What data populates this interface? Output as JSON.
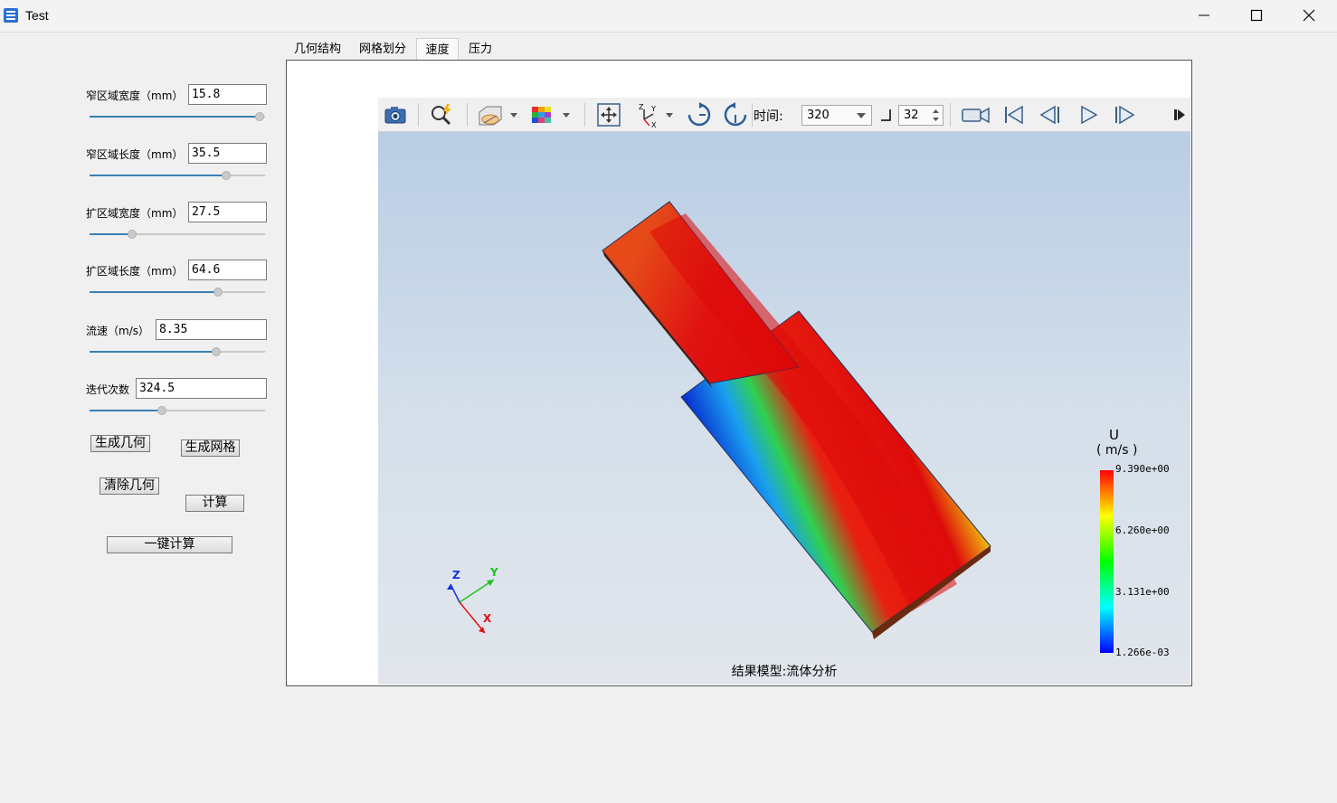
{
  "window": {
    "title": "Test"
  },
  "params": [
    {
      "label": "窄区域宽度（mm）",
      "value": "15.8",
      "level": 0.97
    },
    {
      "label": "窄区域长度（mm）",
      "value": "35.5",
      "level": 0.78
    },
    {
      "label": "扩区域宽度（mm）",
      "value": "27.5",
      "level": 0.24
    },
    {
      "label": "扩区域长度（mm）",
      "value": "64.6",
      "level": 0.73
    },
    {
      "label": "流速（m/s）",
      "value": "8.35",
      "level": 0.72
    },
    {
      "label": "迭代次数",
      "value": "324.5",
      "level": 0.41
    }
  ],
  "buttons": {
    "gen_geometry": "生成几何",
    "gen_mesh": "生成网格",
    "clear_geometry": "清除几何",
    "compute": "计算",
    "one_click": "一键计算"
  },
  "tabs": [
    {
      "label": "几何结构",
      "active": false
    },
    {
      "label": "网格划分",
      "active": false
    },
    {
      "label": "速度",
      "active": true
    },
    {
      "label": "压力",
      "active": false
    }
  ],
  "toolbar": {
    "time_label": "时间:",
    "time_value": "320",
    "step_value": "32",
    "icons": [
      "camera-icon",
      "zoom-icon",
      "display-mode-icon",
      "color-cube-icon",
      "fit-view-icon",
      "axes-icon",
      "rotate-cw-icon",
      "rotate-ccw-icon",
      "record-icon",
      "first-frame-icon",
      "prev-frame-icon",
      "play-icon",
      "next-frame-icon",
      "expand-icon"
    ]
  },
  "viewer": {
    "caption": "结果模型:流体分析",
    "legend": {
      "title": "U",
      "unit": "( m/s )",
      "ticks": [
        "9.390e+00",
        "6.260e+00",
        "3.131e+00",
        "1.266e-03"
      ]
    },
    "axes": {
      "x": "X",
      "y": "Y",
      "z": "Z"
    }
  },
  "colors": {
    "slider_fill": "#3c7fb1",
    "bg_top": "#b9cde4",
    "bg_bottom": "#e2e6ec",
    "axis_x": "#e01010",
    "axis_y": "#20c020",
    "axis_z": "#1030e0"
  }
}
